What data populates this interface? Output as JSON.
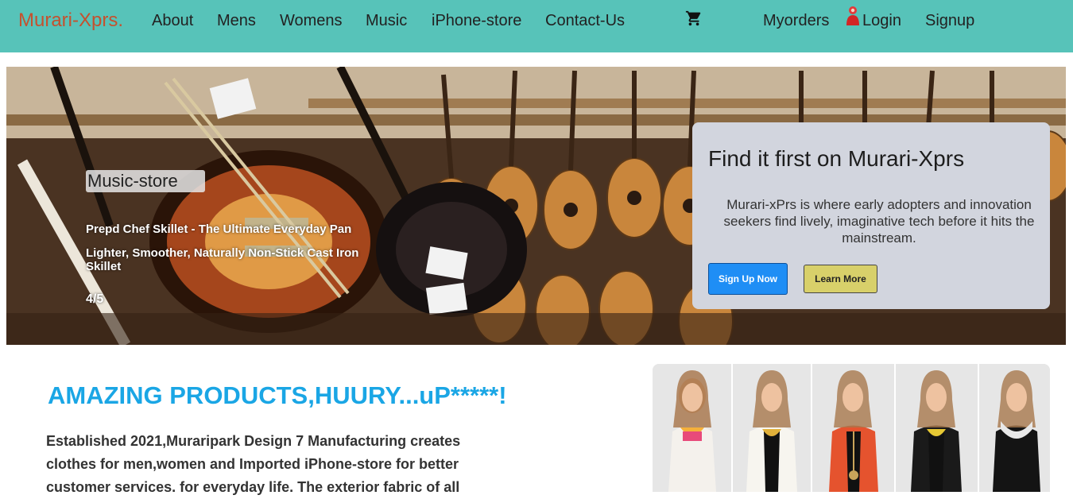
{
  "nav": {
    "brand": "Murari-Xprs.",
    "links": [
      "About",
      "Mens",
      "Womens",
      "Music",
      "iPhone-store",
      "Contact-Us"
    ],
    "myorders": "Myorders",
    "login": "Login",
    "signup": "Signup",
    "icons": {
      "cart": "shopping-cart-icon",
      "login": "person-icon"
    }
  },
  "hero": {
    "badge": "Music-store",
    "caption_title": "Prepd Chef Skillet - The Ultimate Everyday Pan",
    "caption_sub": "Lighter, Smoother, Naturally Non-Stick Cast Iron Skillet",
    "slide_counter": "4/5",
    "card": {
      "title": "Find it first on Murari-Xprs",
      "text": "Murari-xPrs is where early adopters and innovation seekers find lively, imaginative tech before it hits the mainstream.",
      "signup_btn": "Sign Up Now",
      "learn_btn": "Learn More"
    }
  },
  "promo": {
    "headline": "AMAZING PRODUCTS,HUURY...uP*****!",
    "body": "Established 2021,Muraripark Design 7 Manufacturing creates clothes for men,women and Imported iPhone-store for better customer services. for everyday life. The exterior fabric of all"
  },
  "colors": {
    "navbar": "#57c3b9",
    "brand": "#c5512e",
    "headline": "#1aa6e5",
    "signup_btn": "#1f8ef5",
    "learn_btn": "#d8d06a"
  }
}
